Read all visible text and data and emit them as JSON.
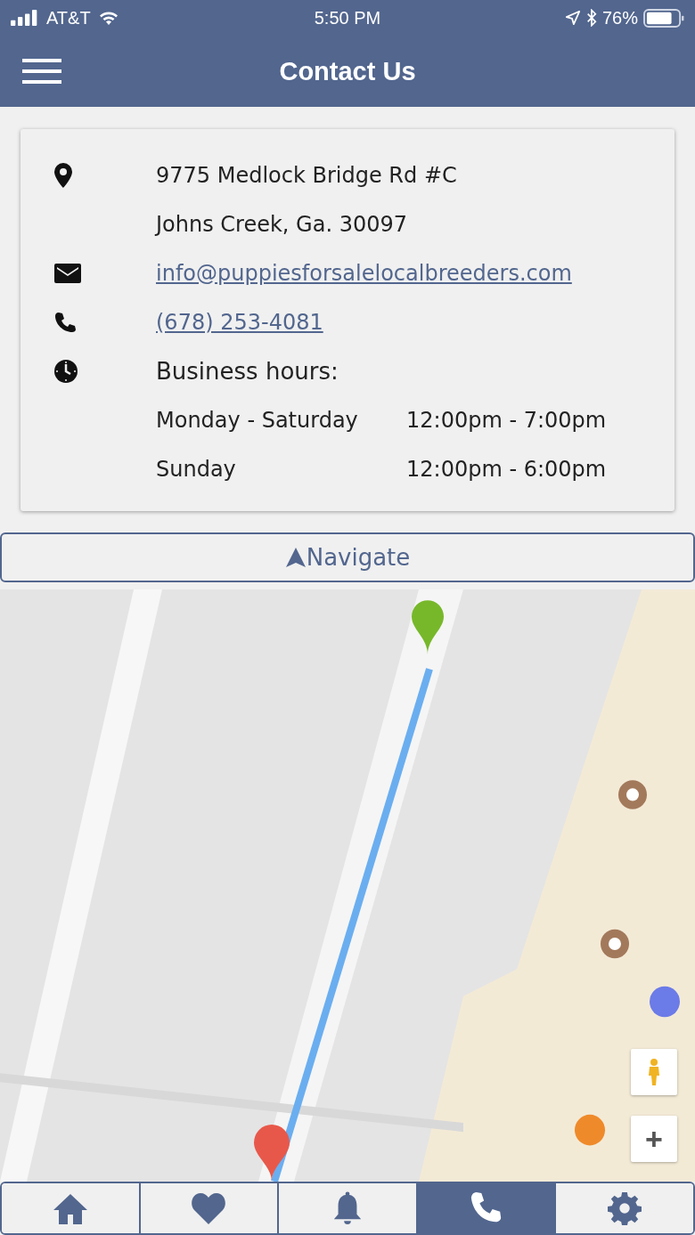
{
  "status_bar": {
    "carrier": "AT&T",
    "time": "5:50 PM",
    "battery": "76%"
  },
  "header": {
    "title": "Contact Us"
  },
  "contact": {
    "address": [
      "9775 Medlock Bridge Rd #C",
      "Johns Creek, Ga. 30097"
    ],
    "email": "info@puppiesforsalelocalbreeders.com",
    "phone": "(678) 253-4081",
    "hours_title": "Business hours:",
    "hours": [
      {
        "days": "Monday - Saturday",
        "time": "12:00pm - 7:00pm"
      },
      {
        "days": "Sunday",
        "time": "12:00pm - 6:00pm"
      }
    ]
  },
  "navigate_button": {
    "label": "Navigate"
  },
  "map": {
    "kind": "picture",
    "zoom_in": "+"
  },
  "tabs": [
    {
      "kind": "home",
      "selected": false
    },
    {
      "kind": "heart",
      "selected": false
    },
    {
      "kind": "bell",
      "selected": false
    },
    {
      "kind": "phone",
      "selected": true
    },
    {
      "kind": "gear",
      "selected": false
    }
  ]
}
